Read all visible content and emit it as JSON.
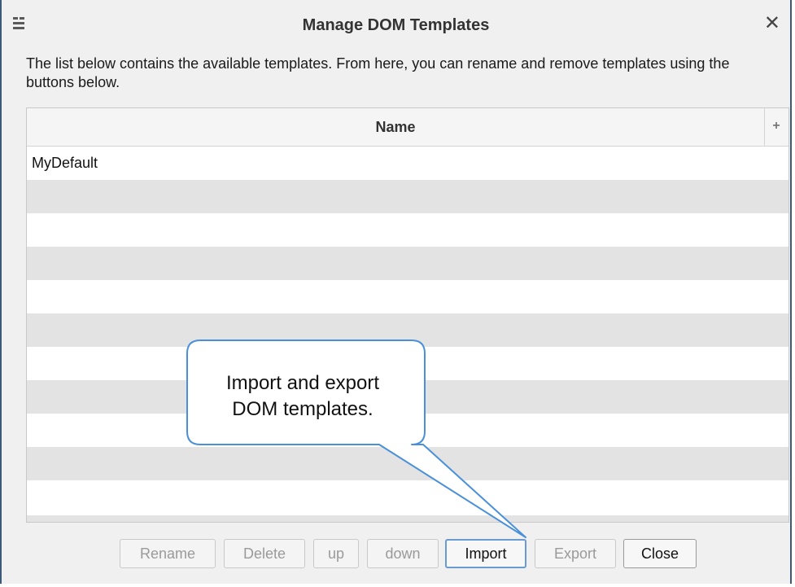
{
  "dialog": {
    "title": "Manage DOM Templates",
    "close_symbol": "✕",
    "description": "The list below contains the available templates.  From here, you can rename and remove templates using the buttons below."
  },
  "table": {
    "column_header": "Name",
    "add_column_symbol": "+",
    "rows": [
      "MyDefault"
    ]
  },
  "buttons": {
    "rename": "Rename",
    "delete": "Delete",
    "up": "up",
    "down": "down",
    "import": "Import",
    "export": "Export",
    "close": "Close"
  },
  "callout": {
    "line1": "Import and export",
    "line2": "DOM templates."
  },
  "colors": {
    "dialog_border": "#3c5a78",
    "callout_border": "#4a90d9",
    "alt_row": "#e3e3e3"
  }
}
